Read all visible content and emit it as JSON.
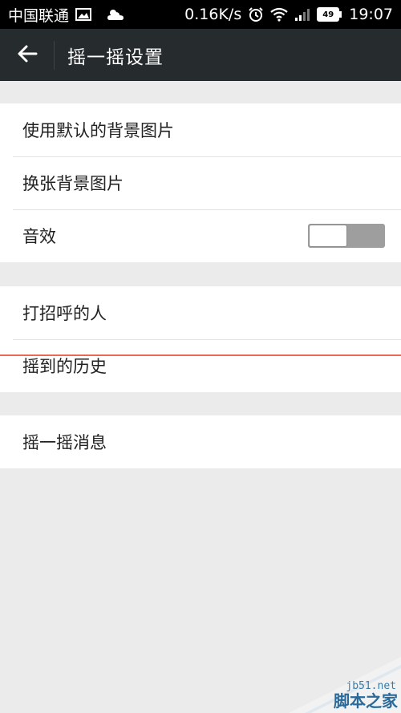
{
  "status_bar": {
    "carrier": "中国联通",
    "network_speed": "0.16K/s",
    "battery_level": "49",
    "time": "19:07",
    "icons": [
      "image-icon",
      "weather-icon",
      "alarm-icon",
      "wifi-icon",
      "signal-icon",
      "battery-icon"
    ]
  },
  "toolbar": {
    "back_icon": "arrow-left-icon",
    "title": "摇一摇设置"
  },
  "settings": {
    "group1": [
      {
        "label": "使用默认的背景图片"
      },
      {
        "label": "换张背景图片"
      },
      {
        "label": "音效",
        "toggle": "off"
      }
    ],
    "group2": [
      {
        "label": "打招呼的人"
      },
      {
        "label": "摇到的历史"
      }
    ],
    "group3": [
      {
        "label": "摇一摇消息"
      }
    ]
  },
  "watermark": {
    "url": "jb51.net",
    "name": "脚本之家"
  },
  "colors": {
    "toolbar_bg": "#262b2e",
    "page_bg": "#ebebeb",
    "annotation_line": "#e86a56"
  }
}
